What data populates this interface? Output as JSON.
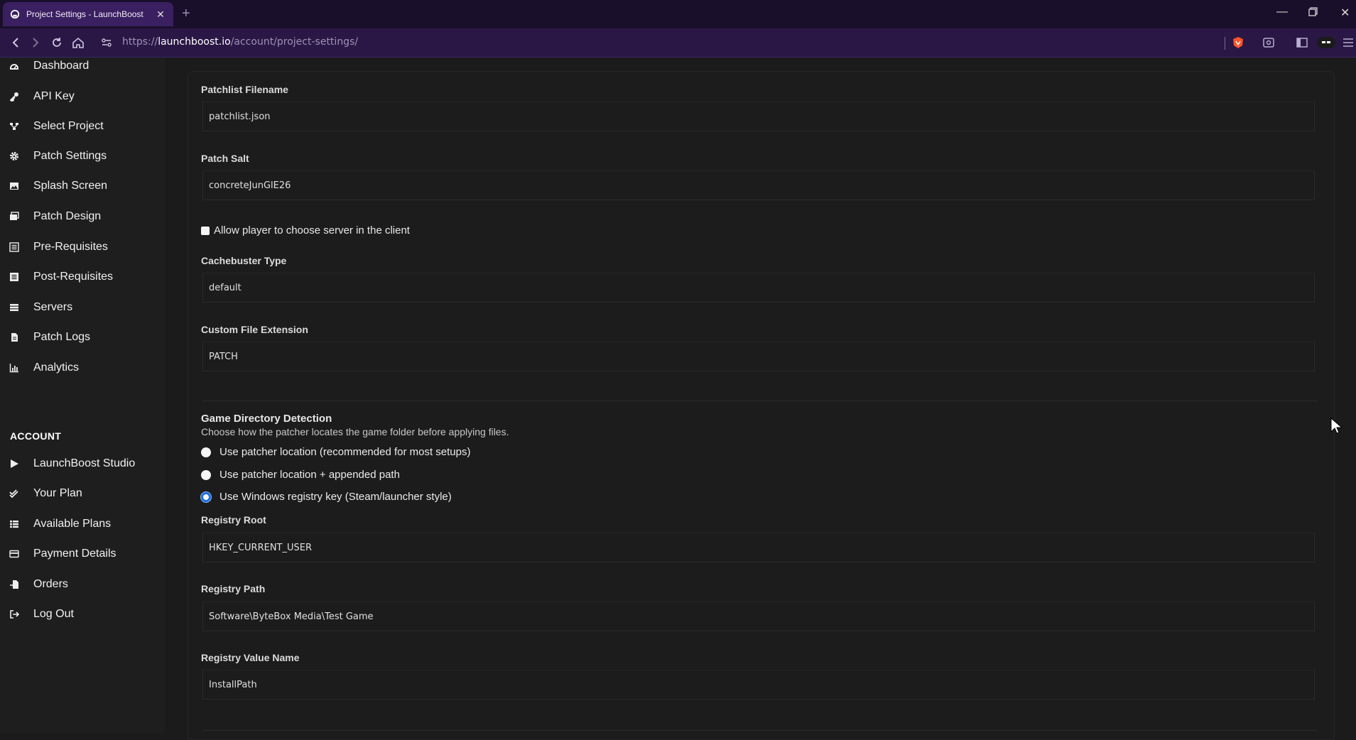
{
  "browser": {
    "tab_title": "Project Settings - LaunchBoost",
    "new_tab": "+",
    "url_prefix": "https://",
    "url_host": "launchboost.io",
    "url_path": "/account/project-settings/"
  },
  "sidebar": {
    "items": [
      {
        "label": "Dashboard",
        "icon": "dashboard-icon"
      },
      {
        "label": "API Key",
        "icon": "key-icon"
      },
      {
        "label": "Select Project",
        "icon": "project-tree-icon"
      },
      {
        "label": "Patch Settings",
        "icon": "gear-icon"
      },
      {
        "label": "Splash Screen",
        "icon": "image-icon"
      },
      {
        "label": "Patch Design",
        "icon": "images-icon"
      },
      {
        "label": "Pre-Requisites",
        "icon": "list-icon"
      },
      {
        "label": "Post-Requisites",
        "icon": "list-alt-icon"
      },
      {
        "label": "Servers",
        "icon": "server-icon"
      },
      {
        "label": "Patch Logs",
        "icon": "file-icon"
      },
      {
        "label": "Analytics",
        "icon": "chart-icon"
      }
    ],
    "account_title": "ACCOUNT",
    "account_items": [
      {
        "label": "LaunchBoost Studio",
        "icon": "play-icon"
      },
      {
        "label": "Your Plan",
        "icon": "check-double-icon"
      },
      {
        "label": "Available Plans",
        "icon": "list-grid-icon"
      },
      {
        "label": "Payment Details",
        "icon": "credit-card-icon"
      },
      {
        "label": "Orders",
        "icon": "file-import-icon"
      },
      {
        "label": "Log Out",
        "icon": "logout-icon"
      }
    ]
  },
  "form": {
    "patchlist_filename": {
      "label": "Patchlist Filename",
      "value": "patchlist.json"
    },
    "patch_salt": {
      "label": "Patch Salt",
      "value": "concreteJunGlE26"
    },
    "allow_server_choice": {
      "label": "Allow player to choose server in the client",
      "checked": false
    },
    "cachebuster_type": {
      "label": "Cachebuster Type",
      "value": "default"
    },
    "custom_extension": {
      "label": "Custom File Extension",
      "value": "PATCH"
    },
    "game_dir": {
      "title": "Game Directory Detection",
      "subtitle": "Choose how the patcher locates the game folder before applying files.",
      "options": [
        "Use patcher location (recommended for most setups)",
        "Use patcher location + appended path",
        "Use Windows registry key (Steam/launcher style)"
      ],
      "selected": 2
    },
    "registry_root": {
      "label": "Registry Root",
      "value": "HKEY_CURRENT_USER"
    },
    "registry_path": {
      "label": "Registry Path",
      "value": "Software\\ByteBox Media\\Test Game"
    },
    "registry_value_name": {
      "label": "Registry Value Name",
      "value": "InstallPath"
    }
  },
  "colors": {
    "titlebar": "#1a0f2b",
    "tab_active": "#3a2060",
    "addressbar": "#2a1745",
    "radio_selected": "#1a6fe0"
  }
}
